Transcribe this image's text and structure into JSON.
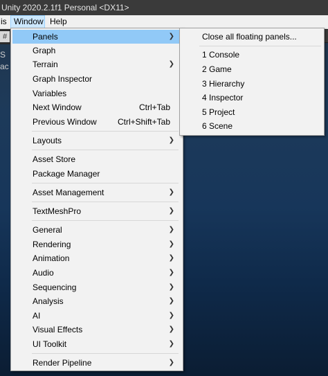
{
  "window": {
    "title": "Unity 2020.2.1f1 Personal <DX11>"
  },
  "menubar": {
    "items": [
      {
        "label": "is"
      },
      {
        "label": "Window"
      },
      {
        "label": "Help"
      }
    ],
    "active": "Window"
  },
  "background": {
    "left_glyphs": [
      "S",
      "ac"
    ]
  },
  "window_menu": {
    "items": [
      {
        "label": "Panels",
        "shortcut": "",
        "submenu": true,
        "highlighted": true
      },
      {
        "label": "Graph",
        "shortcut": "",
        "submenu": false
      },
      {
        "label": "Terrain",
        "shortcut": "",
        "submenu": true
      },
      {
        "label": "Graph Inspector",
        "shortcut": "",
        "submenu": false
      },
      {
        "label": "Variables",
        "shortcut": "",
        "submenu": false
      },
      {
        "label": "Next Window",
        "shortcut": "Ctrl+Tab",
        "submenu": false
      },
      {
        "label": "Previous Window",
        "shortcut": "Ctrl+Shift+Tab",
        "submenu": false
      },
      {
        "label": "Layouts",
        "shortcut": "",
        "submenu": true
      },
      {
        "label": "Asset Store",
        "shortcut": "",
        "submenu": false
      },
      {
        "label": "Package Manager",
        "shortcut": "",
        "submenu": false
      },
      {
        "label": "Asset Management",
        "shortcut": "",
        "submenu": true
      },
      {
        "label": "TextMeshPro",
        "shortcut": "",
        "submenu": true
      },
      {
        "label": "General",
        "shortcut": "",
        "submenu": true
      },
      {
        "label": "Rendering",
        "shortcut": "",
        "submenu": true
      },
      {
        "label": "Animation",
        "shortcut": "",
        "submenu": true
      },
      {
        "label": "Audio",
        "shortcut": "",
        "submenu": true
      },
      {
        "label": "Sequencing",
        "shortcut": "",
        "submenu": true
      },
      {
        "label": "Analysis",
        "shortcut": "",
        "submenu": true
      },
      {
        "label": "AI",
        "shortcut": "",
        "submenu": true
      },
      {
        "label": "Visual Effects",
        "shortcut": "",
        "submenu": true
      },
      {
        "label": "UI Toolkit",
        "shortcut": "",
        "submenu": true
      },
      {
        "label": "Render Pipeline",
        "shortcut": "",
        "submenu": true
      }
    ]
  },
  "panels_submenu": {
    "items": [
      {
        "label": "Close all floating panels..."
      },
      {
        "label": "1 Console"
      },
      {
        "label": "2 Game"
      },
      {
        "label": "3 Hierarchy"
      },
      {
        "label": "4 Inspector"
      },
      {
        "label": "5 Project"
      },
      {
        "label": "6 Scene"
      }
    ]
  },
  "icons": {
    "submenu_arrow": "chevron-right-icon",
    "toolbar_hash": "hash-icon"
  },
  "colors": {
    "highlight": "#91c9f7",
    "menu_bg": "#f2f2f2",
    "titlebar_bg": "#3a3a3a",
    "menubar_active": "#cce8ff"
  }
}
